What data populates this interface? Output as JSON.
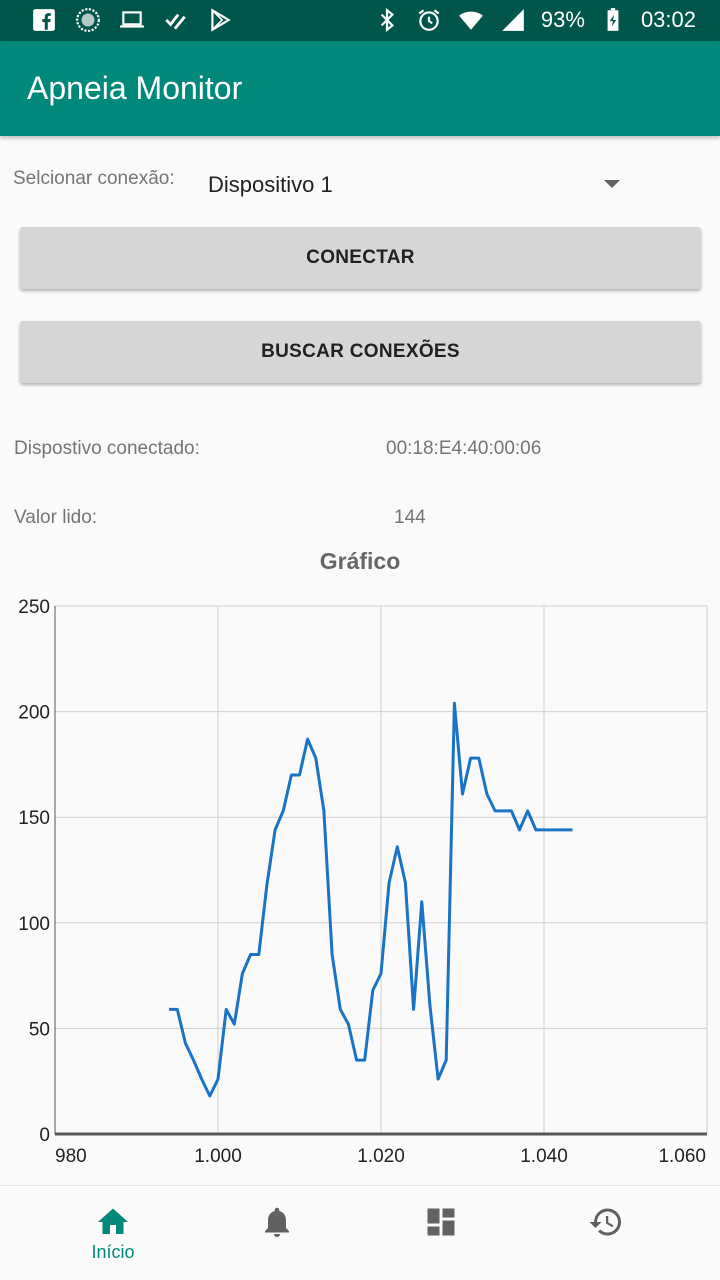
{
  "status_bar": {
    "battery": "93%",
    "time": "03:02"
  },
  "app": {
    "title": "Apneia Monitor"
  },
  "connection": {
    "select_label": "Selcionar conexão:",
    "selected_device": "Dispositivo 1",
    "connect_button": "CONECTAR",
    "search_button": "BUSCAR CONEXÕES"
  },
  "info": {
    "connected_label": "Dispostivo conectado:",
    "connected_value": "00:18:E4:40:00:06",
    "read_label": "Valor lido:",
    "read_value": "144"
  },
  "chart_title": "Gráfico",
  "chart_data": {
    "type": "line",
    "title": "",
    "xlabel": "",
    "ylabel": "",
    "xlim": [
      980,
      1060
    ],
    "ylim": [
      0,
      250
    ],
    "x_ticks": [
      "980",
      "1.000",
      "1.020",
      "1.040",
      "1.060"
    ],
    "x_tick_values": [
      980,
      1000,
      1020,
      1040,
      1060
    ],
    "y_ticks": [
      "0",
      "50",
      "100",
      "150",
      "200",
      "250"
    ],
    "y_tick_values": [
      0,
      50,
      100,
      150,
      200,
      250
    ],
    "grid": true,
    "color": "#1a73c4",
    "series": [
      {
        "name": "",
        "x": [
          994,
          995,
          996,
          997,
          998,
          999,
          1000,
          1001,
          1002,
          1003,
          1004,
          1005,
          1006,
          1007,
          1008,
          1009,
          1010,
          1011,
          1012,
          1013,
          1014,
          1015,
          1016,
          1017,
          1018,
          1019,
          1020,
          1021,
          1022,
          1023,
          1024,
          1025,
          1026,
          1027,
          1028,
          1029,
          1030,
          1031,
          1032,
          1033,
          1034,
          1035,
          1036,
          1037,
          1038,
          1039,
          1040,
          1041,
          1042,
          1043,
          1043.5
        ],
        "y": [
          59,
          59,
          43,
          35,
          26,
          18,
          26,
          59,
          52,
          76,
          85,
          85,
          118,
          144,
          153,
          170,
          170,
          187,
          178,
          153,
          85,
          59,
          52,
          35,
          35,
          68,
          76,
          119,
          136,
          119,
          59,
          110,
          61,
          26,
          35,
          204,
          161,
          178,
          178,
          161,
          153,
          153,
          153,
          144,
          153,
          144,
          144,
          144,
          144,
          144,
          144
        ]
      }
    ]
  },
  "nav": {
    "home_label": "Início"
  },
  "colors": {
    "status_bar": "#00564b",
    "primary": "#00897b",
    "button_bg": "#d6d6d6",
    "line": "#1a73c4"
  }
}
